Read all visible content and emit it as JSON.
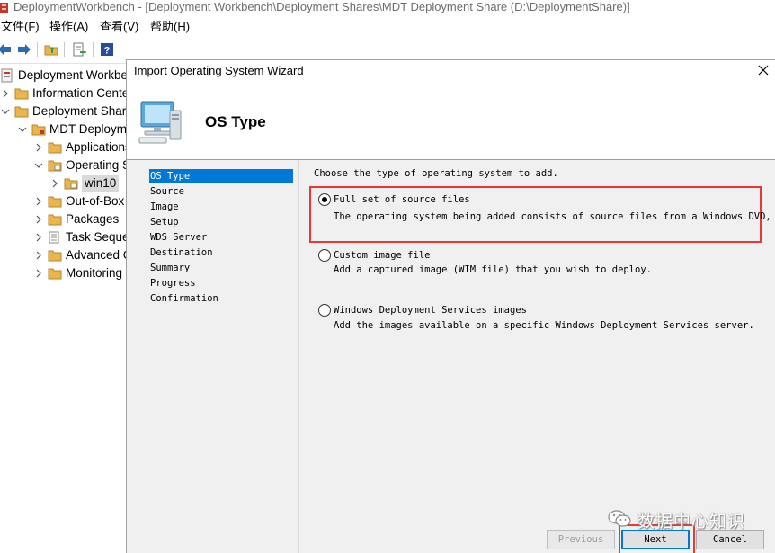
{
  "window": {
    "title": "DeploymentWorkbench - [Deployment Workbench\\Deployment Shares\\MDT Deployment Share (D:\\DeploymentShare)]"
  },
  "menu": {
    "items": [
      "文件(F)",
      "操作(A)",
      "查看(V)",
      "帮助(H)"
    ]
  },
  "toolbar": {
    "icons": [
      "back-arrow-icon",
      "forward-arrow-icon",
      "up-folder-icon",
      "export-list-icon",
      "help-icon"
    ]
  },
  "tree": {
    "items": [
      {
        "label": "Deployment Workbench",
        "expander": "none"
      },
      {
        "label": "Information Center",
        "expander": "collapsed"
      },
      {
        "label": "Deployment Shares",
        "expander": "expanded"
      },
      {
        "label": "MDT Deployment Share",
        "expander": "expanded"
      },
      {
        "label": "Applications",
        "expander": "collapsed"
      },
      {
        "label": "Operating Systems",
        "expander": "expanded"
      },
      {
        "label": "win10",
        "expander": "collapsed"
      },
      {
        "label": "Out-of-Box Drivers",
        "expander": "collapsed"
      },
      {
        "label": "Packages",
        "expander": "collapsed"
      },
      {
        "label": "Task Sequences",
        "expander": "collapsed"
      },
      {
        "label": "Advanced Configuration",
        "expander": "collapsed"
      },
      {
        "label": "Monitoring",
        "expander": "collapsed"
      }
    ]
  },
  "wizard": {
    "title": "Import Operating System Wizard",
    "heading": "OS Type",
    "steps": [
      "OS Type",
      "Source",
      "Image",
      "Setup",
      "WDS Server",
      "Destination",
      "Summary",
      "Progress",
      "Confirmation"
    ],
    "active_step": "OS Type",
    "prompt": "Choose the type of operating system to add.",
    "options": [
      {
        "label": "Full set of source files",
        "description": "The operating system being added consists of source files from a Windows DVD,",
        "selected": true
      },
      {
        "label": "Custom image file",
        "description": "Add a captured image (WIM file) that you wish to deploy.",
        "selected": false
      },
      {
        "label": "Windows Deployment Services images",
        "description": "Add the images available on a specific Windows Deployment Services server.",
        "selected": false
      }
    ],
    "buttons": {
      "previous": "Previous",
      "next": "Next",
      "cancel": "Cancel"
    }
  },
  "watermark": {
    "text": "数据中心知识"
  },
  "colors": {
    "selection": "#0078d7",
    "highlight": "#e53935",
    "panel_bg": "#f0f0f0"
  }
}
